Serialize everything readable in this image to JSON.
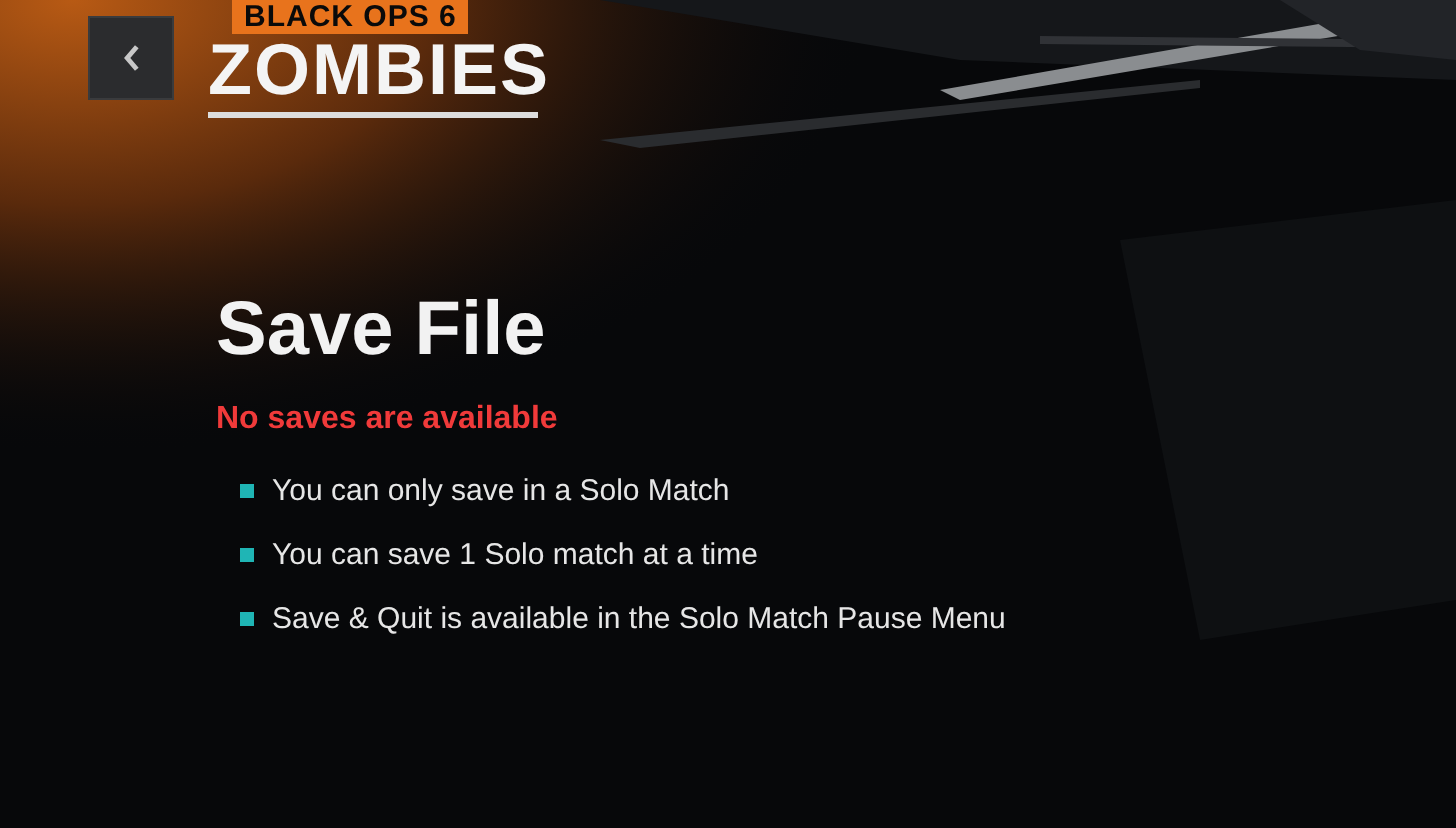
{
  "header": {
    "logo_top": "BLACK OPS 6",
    "logo_bottom": "ZOMBIES"
  },
  "title": "Save File",
  "status": "No saves are available",
  "notes": [
    "You can only save in a Solo Match",
    "You can save 1 Solo match at a time",
    "Save & Quit is available in the Solo Match Pause Menu"
  ]
}
